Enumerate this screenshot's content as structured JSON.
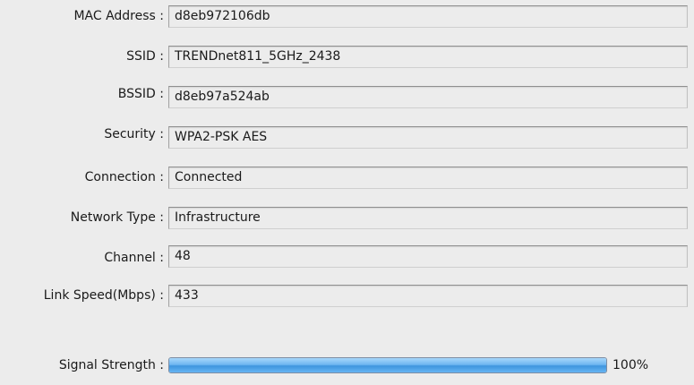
{
  "fields": [
    {
      "label": "MAC Address :",
      "value": "d8eb972106db"
    },
    {
      "label": "SSID :",
      "value": "TRENDnet811_5GHz_2438"
    },
    {
      "label": "BSSID :",
      "value": "d8eb97a524ab"
    },
    {
      "label": "Security :",
      "value": "WPA2-PSK AES"
    },
    {
      "label": "Connection :",
      "value": "Connected"
    },
    {
      "label": "Network Type :",
      "value": "Infrastructure"
    },
    {
      "label": "Channel :",
      "value": "48"
    },
    {
      "label": "Link Speed(Mbps) :",
      "value": "433"
    }
  ],
  "signal": {
    "label": "Signal Strength :",
    "percent": 100,
    "percent_text": "100%",
    "bar_color": "#4aa3ea"
  }
}
